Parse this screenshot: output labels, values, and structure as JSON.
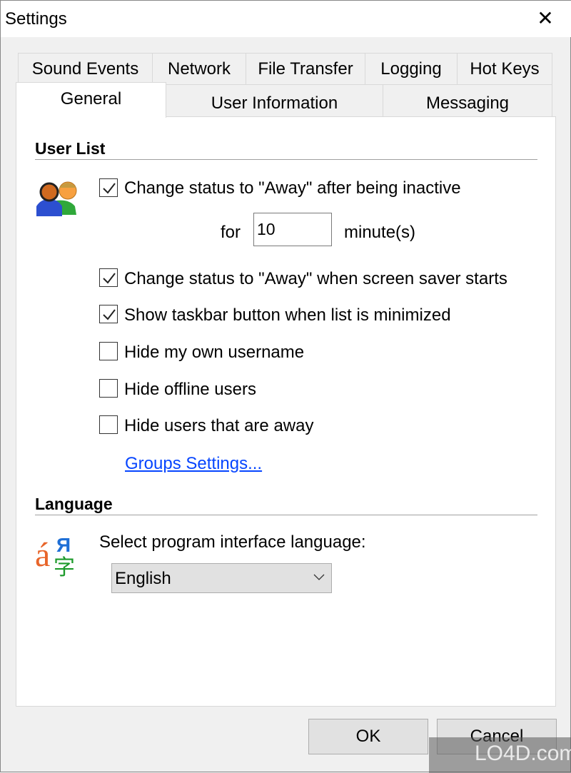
{
  "window": {
    "title": "Settings",
    "close_icon": "close-icon"
  },
  "tabs_row1": [
    {
      "label": "Sound Events"
    },
    {
      "label": "Network"
    },
    {
      "label": "File Transfer"
    },
    {
      "label": "Logging"
    },
    {
      "label": "Hot Keys"
    }
  ],
  "tabs_row2": [
    {
      "label": "General",
      "selected": true
    },
    {
      "label": "User Information"
    },
    {
      "label": "Messaging"
    }
  ],
  "user_list": {
    "heading": "User List",
    "icon": "users-icon",
    "options": [
      {
        "label": "Change status to \"Away\" after being inactive",
        "checked": true
      },
      {
        "label": "Change status to \"Away\" when screen saver starts",
        "checked": true
      },
      {
        "label": "Show taskbar button when list is minimized",
        "checked": true
      },
      {
        "label": "Hide my own username",
        "checked": false
      },
      {
        "label": "Hide offline users",
        "checked": false
      },
      {
        "label": "Hide users that are away",
        "checked": false
      }
    ],
    "for_label": "for",
    "minutes_value": "10",
    "minutes_unit": "minute(s)",
    "groups_link": "Groups Settings..."
  },
  "language": {
    "heading": "Language",
    "icon": "language-icon",
    "prompt": "Select program interface language:",
    "selected": "English"
  },
  "buttons": {
    "ok": "OK",
    "cancel": "Cancel"
  },
  "watermark": "LO4D.com"
}
